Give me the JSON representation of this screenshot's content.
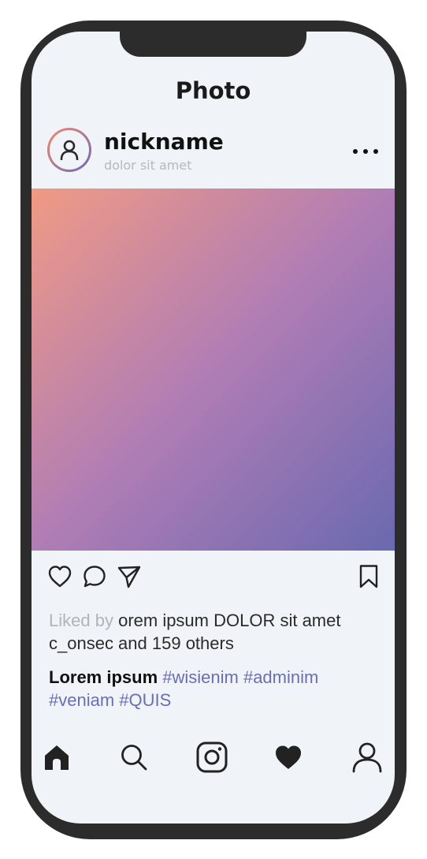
{
  "header": {
    "title": "Photo"
  },
  "post": {
    "nickname": "nickname",
    "subtitle": "dolor sit amet"
  },
  "actions": {
    "icons": [
      "heart-outline-icon",
      "comment-icon",
      "send-icon",
      "bookmark-icon"
    ]
  },
  "likes": {
    "prefix": "Liked by",
    "text": "orem ipsum DOLOR sit amet c_onsec and 159 others"
  },
  "caption": {
    "author": "Lorem ipsum",
    "hashtags": "#wisienim #adminim #veniam #QUIS"
  },
  "bottom_nav": {
    "icons": [
      "home-icon",
      "search-icon",
      "instagram-icon",
      "heart-filled-icon",
      "profile-icon"
    ]
  },
  "colors": {
    "phone_frame": "#2c2c2c",
    "screen_bg": "#f0f3f7",
    "gradient_start": "#f09a84",
    "gradient_mid": "#b07db5",
    "gradient_end": "#6a69b0",
    "hashtag": "#6a6fb3",
    "muted_text": "#b0b4bb"
  }
}
